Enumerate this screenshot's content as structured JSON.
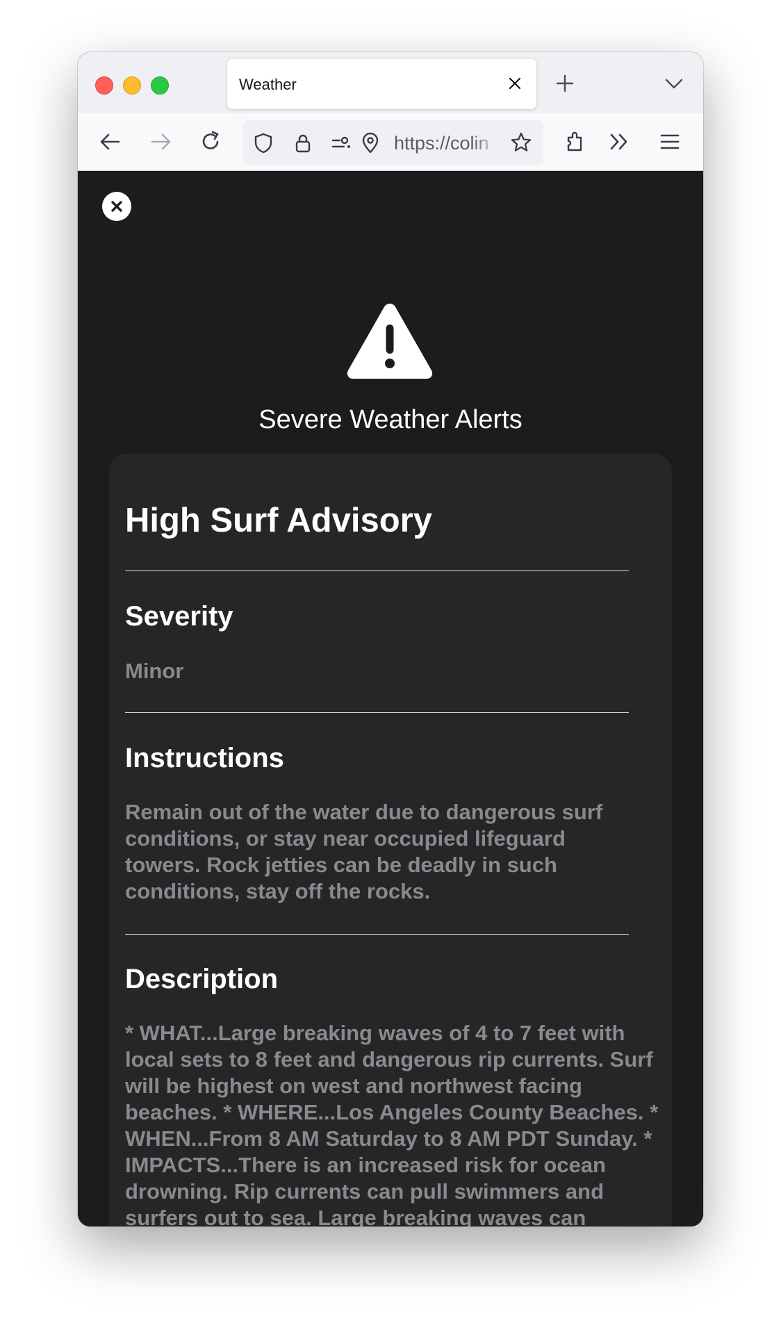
{
  "browser": {
    "tab_title": "Weather",
    "url_text": "https://colin"
  },
  "modal": {
    "alerts_title": "Severe Weather Alerts",
    "alert_name": "High Surf Advisory",
    "severity_heading": "Severity",
    "severity_value": "Minor",
    "instructions_heading": "Instructions",
    "instructions_text": "Remain out of the water due to dangerous surf conditions, or stay near occupied lifeguard towers. Rock jetties can be deadly in such conditions, stay off the rocks.",
    "description_heading": "Description",
    "description_text": "* WHAT...Large breaking waves of 4 to 7 feet with local sets to 8 feet and dangerous rip currents. Surf will be highest on west and northwest facing beaches. * WHERE...Los Angeles County Beaches. * WHEN...From 8 AM Saturday to 8 AM PDT Sunday. * IMPACTS...There is an increased risk for ocean drowning. Rip currents can pull swimmers and surfers out to sea. Large breaking waves can"
  },
  "icons": {
    "close": "close-icon",
    "warning": "warning-triangle-icon"
  },
  "colors": {
    "background": "#1c1c1e",
    "card": "#262628",
    "muted_text": "#8a8a8e"
  }
}
